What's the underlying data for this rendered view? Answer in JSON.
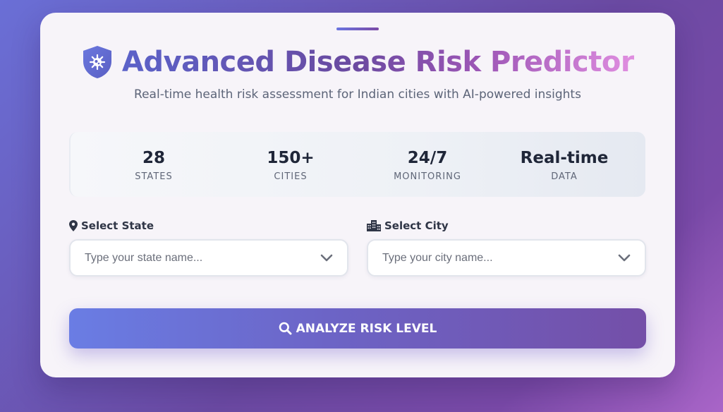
{
  "header": {
    "title": "Advanced Disease Risk Predictor",
    "subtitle": "Real-time health risk assessment for Indian cities with AI-powered insights",
    "icon": "shield-virus-icon"
  },
  "stats": [
    {
      "value": "28",
      "label": "STATES"
    },
    {
      "value": "150+",
      "label": "CITIES"
    },
    {
      "value": "24/7",
      "label": "MONITORING"
    },
    {
      "value": "Real-time",
      "label": "DATA"
    }
  ],
  "form": {
    "state": {
      "label": "Select State",
      "placeholder": "Type your state name...",
      "icon": "map-pin-icon"
    },
    "city": {
      "label": "Select City",
      "placeholder": "Type your city name...",
      "icon": "city-buildings-icon"
    }
  },
  "action": {
    "label": "ANALYZE RISK LEVEL",
    "icon": "search-icon"
  },
  "colors": {
    "accent_start": "#667eea",
    "accent_end": "#764ba2",
    "title_highlight": "#e08ee0"
  }
}
